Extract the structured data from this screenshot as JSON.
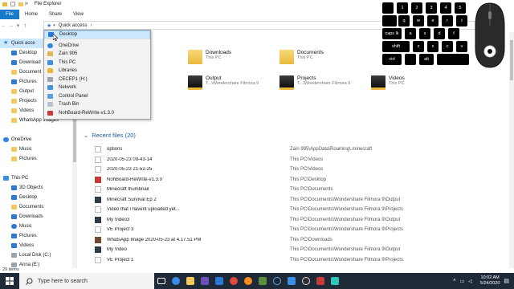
{
  "window": {
    "title": "File Explorer"
  },
  "ribbon": {
    "tabs": [
      "File",
      "Home",
      "Share",
      "View"
    ]
  },
  "address": {
    "text": "Quick access"
  },
  "sidebar": {
    "items": [
      {
        "label": "Quick acce",
        "icon": "star-icon",
        "selected": true
      },
      {
        "label": "Desktop",
        "icon": "desktop-icon"
      },
      {
        "label": "Download",
        "icon": "downloads-icon"
      },
      {
        "label": "Document",
        "icon": "documents-icon"
      },
      {
        "label": "Pictures",
        "icon": "pictures-icon"
      },
      {
        "label": "Output",
        "icon": "folder-icon"
      },
      {
        "label": "Projects",
        "icon": "folder-icon"
      },
      {
        "label": "Videos",
        "icon": "folder-icon"
      },
      {
        "label": "WhatsApp Images",
        "icon": "folder-icon"
      },
      {
        "label": "",
        "icon": "none"
      },
      {
        "label": "OneDrive",
        "icon": "cloud-icon"
      },
      {
        "label": "Music",
        "icon": "folder-icon"
      },
      {
        "label": "Pictures",
        "icon": "folder-icon"
      },
      {
        "label": "",
        "icon": "none"
      },
      {
        "label": "This PC",
        "icon": "pc-icon"
      },
      {
        "label": "3D Objects",
        "icon": "cube-icon"
      },
      {
        "label": "Desktop",
        "icon": "desktop-icon"
      },
      {
        "label": "Documents",
        "icon": "documents-icon"
      },
      {
        "label": "Downloads",
        "icon": "downloads-icon"
      },
      {
        "label": "Music",
        "icon": "music-icon"
      },
      {
        "label": "Pictures",
        "icon": "pictures-icon"
      },
      {
        "label": "Videos",
        "icon": "videos-icon"
      },
      {
        "label": "Local Disk (C:)",
        "icon": "drive-icon"
      },
      {
        "label": "Anna (E:)",
        "icon": "drive-icon"
      }
    ]
  },
  "quick_folders": [
    {
      "name": "Downloads",
      "sub": "This PC"
    },
    {
      "name": "Documents",
      "sub": "This PC"
    },
    {
      "name": "Output",
      "sub": "T...\\Wondershare Filmora 9"
    },
    {
      "name": "Projects",
      "sub": "T...\\Wondershare Filmora 9"
    },
    {
      "name": "Videos",
      "sub": "This PC"
    }
  ],
  "recent": {
    "heading": "Recent files (20)",
    "files": [
      {
        "name": "options",
        "path": "Zain 995\\AppData\\Roaming\\.minecraft"
      },
      {
        "name": "2020-05-23 09-43-14",
        "path": "This PC\\Videos"
      },
      {
        "name": "2020-05-23 21-52-25",
        "path": "This PC\\Videos"
      },
      {
        "name": "NohBoard-ReWrite-v1.3.0",
        "path": "This PC\\Desktop"
      },
      {
        "name": "Minecraft thumbnail",
        "path": "This PC\\Documents"
      },
      {
        "name": "Minecraft Survival Ep 2",
        "path": "This PC\\Documents\\Wondershare Filmora 9\\Output"
      },
      {
        "name": "Video that i havent uploaded yet...",
        "path": "This PC\\Documents\\Wondershare Filmora 9\\Projects"
      },
      {
        "name": "My Video3",
        "path": "This PC\\Documents\\Wondershare Filmora 9\\Output"
      },
      {
        "name": "VE Project 3",
        "path": "This PC\\Documents\\Wondershare Filmora 9\\Projects"
      },
      {
        "name": "WhatsApp Image 2020-05-23 at 4.17.51 PM",
        "path": "This PC\\Downloads"
      },
      {
        "name": "My Video",
        "path": "This PC\\Documents\\Wondershare Filmora 9\\Output"
      },
      {
        "name": "VE Project 1",
        "path": "This PC\\Documents\\Wondershare Filmora 9\\Projects"
      }
    ]
  },
  "dropdown": {
    "items": [
      {
        "label": "Desktop"
      },
      {
        "label": "OneDrive"
      },
      {
        "label": "Zain 995"
      },
      {
        "label": "This PC"
      },
      {
        "label": "Libraries"
      },
      {
        "label": "CECEP1 (H:)"
      },
      {
        "label": "Network"
      },
      {
        "label": "Control Panel"
      },
      {
        "label": "Trash Bin"
      },
      {
        "label": "NohBoard-ReWrite-v1.3.0"
      }
    ]
  },
  "status": {
    "count": "29 items"
  },
  "keyboard_overlay": {
    "keys": [
      "1",
      "2",
      "3",
      "4",
      "5",
      "q",
      "w",
      "e",
      "r",
      "t",
      "caps lk",
      "a",
      "s",
      "d",
      "f",
      "shift",
      "z",
      "x",
      "c",
      "v",
      "ctrl",
      "alt"
    ]
  },
  "taskbar": {
    "search_placeholder": "Type here to search",
    "time": "10:02 AM",
    "date": "5/24/2020"
  },
  "colors": {
    "accent": "#1979ca",
    "taskbar": "#1f2a38",
    "link": "#1e5aa8",
    "selection": "#cce8ff"
  }
}
